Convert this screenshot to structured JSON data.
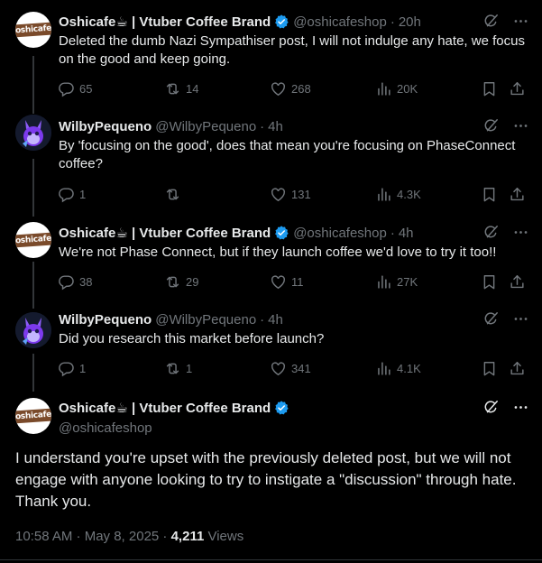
{
  "tweets": [
    {
      "name": "Oshicafe☕ | Vtuber Coffee Brand",
      "handle": "@oshicafeshop",
      "time": "20h",
      "text": "Deleted the dumb Nazi Sympathiser post, I will not indulge any hate, we focus on the good and keep going.",
      "replies": "65",
      "retweets": "14",
      "likes": "268",
      "views": "20K"
    },
    {
      "name": "WilbyPequeno",
      "handle": "@WilbyPequeno",
      "time": "4h",
      "text": "By 'focusing on the good', does that mean  you're focusing on PhaseConnect coffee?",
      "replies": "1",
      "retweets": "",
      "likes": "131",
      "views": "4.3K"
    },
    {
      "name": "Oshicafe☕ | Vtuber Coffee Brand",
      "handle": "@oshicafeshop",
      "time": "4h",
      "text": "We're not Phase Connect, but if they launch coffee we'd love to try it too!!",
      "replies": "38",
      "retweets": "29",
      "likes": "11",
      "views": "27K"
    },
    {
      "name": "WilbyPequeno",
      "handle": "@WilbyPequeno",
      "time": "4h",
      "text": "Did you research this market before launch?",
      "replies": "1",
      "retweets": "1",
      "likes": "341",
      "views": "4.1K"
    }
  ],
  "main": {
    "name": "Oshicafe☕ | Vtuber Coffee Brand",
    "handle": "@oshicafeshop",
    "text": "I understand you're upset with the previously deleted post, but we will not engage with anyone looking to try to instigate a \"discussion\" through hate. Thank you.",
    "timestamp": "10:58 AM · May 8, 2025 · ",
    "views_count": "4,211",
    "views_label": "Views"
  },
  "dot_separator": "·",
  "avatar_logo_text": "oshicafe",
  "colors": {
    "background": "#000000",
    "text": "#e7e9ea",
    "muted": "#71767b",
    "verified": "#1d9bf0",
    "line": "#333639"
  },
  "icons": [
    "verified-badge-icon",
    "grok-icon",
    "more-icon",
    "reply-icon",
    "retweet-icon",
    "like-icon",
    "views-icon",
    "bookmark-icon",
    "share-icon"
  ]
}
